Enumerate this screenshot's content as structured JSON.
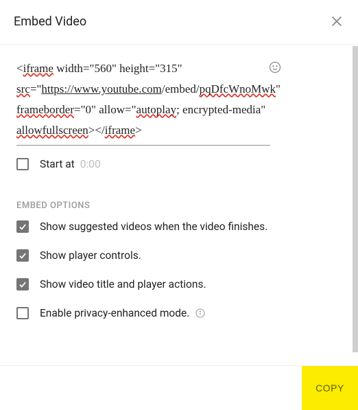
{
  "header": {
    "title": "Embed Video"
  },
  "code": {
    "text": "<iframe width=\"560\" height=\"315\" src=\"https://www.youtube.com/embed/pqDfcWnoMwk\" frameborder=\"0\" allow=\"autoplay; encrypted-media\" allowfullscreen></iframe>"
  },
  "startAt": {
    "label": "Start at",
    "placeholder": "0:00",
    "checked": false
  },
  "sectionTitle": "EMBED OPTIONS",
  "options": [
    {
      "label": "Show suggested videos when the video finishes.",
      "checked": true,
      "info": false
    },
    {
      "label": "Show player controls.",
      "checked": true,
      "info": false
    },
    {
      "label": "Show video title and player actions.",
      "checked": true,
      "info": false
    },
    {
      "label": "Enable privacy-enhanced mode.",
      "checked": false,
      "info": true
    }
  ],
  "footer": {
    "copy": "COPY"
  }
}
